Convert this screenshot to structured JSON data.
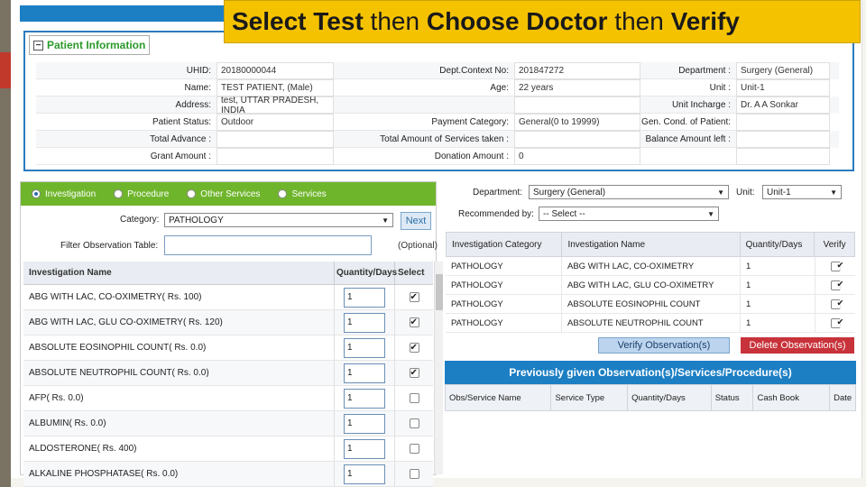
{
  "banner": {
    "part1": "Select Test",
    "part2": " then ",
    "part3": "Choose Doctor",
    "part4": " then ",
    "part5": "Verify"
  },
  "patient_info": {
    "legend": "Patient Information",
    "rows": [
      [
        {
          "label": "UHID:",
          "value": "20180000044"
        },
        {
          "label": "Dept.Context No:",
          "value": "201847272"
        },
        {
          "label": "Department :",
          "value": "Surgery (General)"
        }
      ],
      [
        {
          "label": "Name:",
          "value": "TEST PATIENT, (Male)"
        },
        {
          "label": "Age:",
          "value": "22 years"
        },
        {
          "label": "Unit :",
          "value": "Unit-1"
        }
      ],
      [
        {
          "label": "Address:",
          "value": "test, UTTAR PRADESH, INDIA"
        },
        {
          "label": "",
          "value": ""
        },
        {
          "label": "Unit Incharge :",
          "value": "Dr. A A Sonkar"
        }
      ],
      [
        {
          "label": "Patient Status:",
          "value": "Outdoor"
        },
        {
          "label": "Payment Category:",
          "value": "General(0 to 19999)"
        },
        {
          "label": "Gen. Cond. of Patient:",
          "value": ""
        }
      ],
      [
        {
          "label": "Total Advance :",
          "value": ""
        },
        {
          "label": "Total Amount of Services taken :",
          "value": ""
        },
        {
          "label": "Balance Amount left :",
          "value": ""
        }
      ],
      [
        {
          "label": "Grant Amount :",
          "value": ""
        },
        {
          "label": "Donation Amount :",
          "value": "0"
        },
        {
          "label": "",
          "value": ""
        }
      ]
    ]
  },
  "tabs": [
    {
      "label": "Investigation",
      "selected": true
    },
    {
      "label": "Procedure",
      "selected": false
    },
    {
      "label": "Other Services",
      "selected": false
    },
    {
      "label": "Services",
      "selected": false
    }
  ],
  "category": {
    "label": "Category:",
    "value": "PATHOLOGY",
    "next": "Next"
  },
  "filter": {
    "label": "Filter Observation Table:",
    "optional": "(Optional)"
  },
  "inv_table": {
    "headers": [
      "Investigation Name",
      "Quantity/Days",
      "Select"
    ],
    "rows": [
      {
        "name": "ABG WITH LAC, CO-OXIMETRY( Rs. 100)",
        "qty": "1",
        "checked": true
      },
      {
        "name": "ABG WITH LAC, GLU CO-OXIMETRY( Rs. 120)",
        "qty": "1",
        "checked": true
      },
      {
        "name": "ABSOLUTE EOSINOPHIL COUNT( Rs. 0.0)",
        "qty": "1",
        "checked": true
      },
      {
        "name": "ABSOLUTE NEUTROPHIL COUNT( Rs. 0.0)",
        "qty": "1",
        "checked": true
      },
      {
        "name": "AFP( Rs. 0.0)",
        "qty": "1",
        "checked": false
      },
      {
        "name": "ALBUMIN( Rs. 0.0)",
        "qty": "1",
        "checked": false
      },
      {
        "name": "ALDOSTERONE( Rs. 400)",
        "qty": "1",
        "checked": false
      },
      {
        "name": "ALKALINE PHOSPHATASE( Rs. 0.0)",
        "qty": "1",
        "checked": false
      }
    ]
  },
  "right": {
    "department_label": "Department:",
    "department_value": "Surgery (General)",
    "unit_label": "Unit:",
    "unit_value": "Unit-1",
    "recommended_label": "Recommended by:",
    "recommended_value": "-- Select --",
    "headers": [
      "Investigation Category",
      "Investigation Name",
      "Quantity/Days",
      "Verify"
    ],
    "rows": [
      {
        "cat": "PATHOLOGY",
        "name": "ABG WITH LAC, CO-OXIMETRY",
        "qty": "1",
        "verified": true
      },
      {
        "cat": "PATHOLOGY",
        "name": "ABG WITH LAC, GLU CO-OXIMETRY",
        "qty": "1",
        "verified": true
      },
      {
        "cat": "PATHOLOGY",
        "name": "ABSOLUTE EOSINOPHIL COUNT",
        "qty": "1",
        "verified": true
      },
      {
        "cat": "PATHOLOGY",
        "name": "ABSOLUTE NEUTROPHIL COUNT",
        "qty": "1",
        "verified": true
      }
    ],
    "verify_btn": "Verify Observation(s)",
    "delete_btn": "Delete Observation(s)"
  },
  "previous": {
    "title": "Previously given Observation(s)/Services/Procedure(s)",
    "headers": [
      "Obs/Service Name",
      "Service Type",
      "Quantity/Days",
      "Status",
      "Cash Book",
      "Date"
    ]
  }
}
